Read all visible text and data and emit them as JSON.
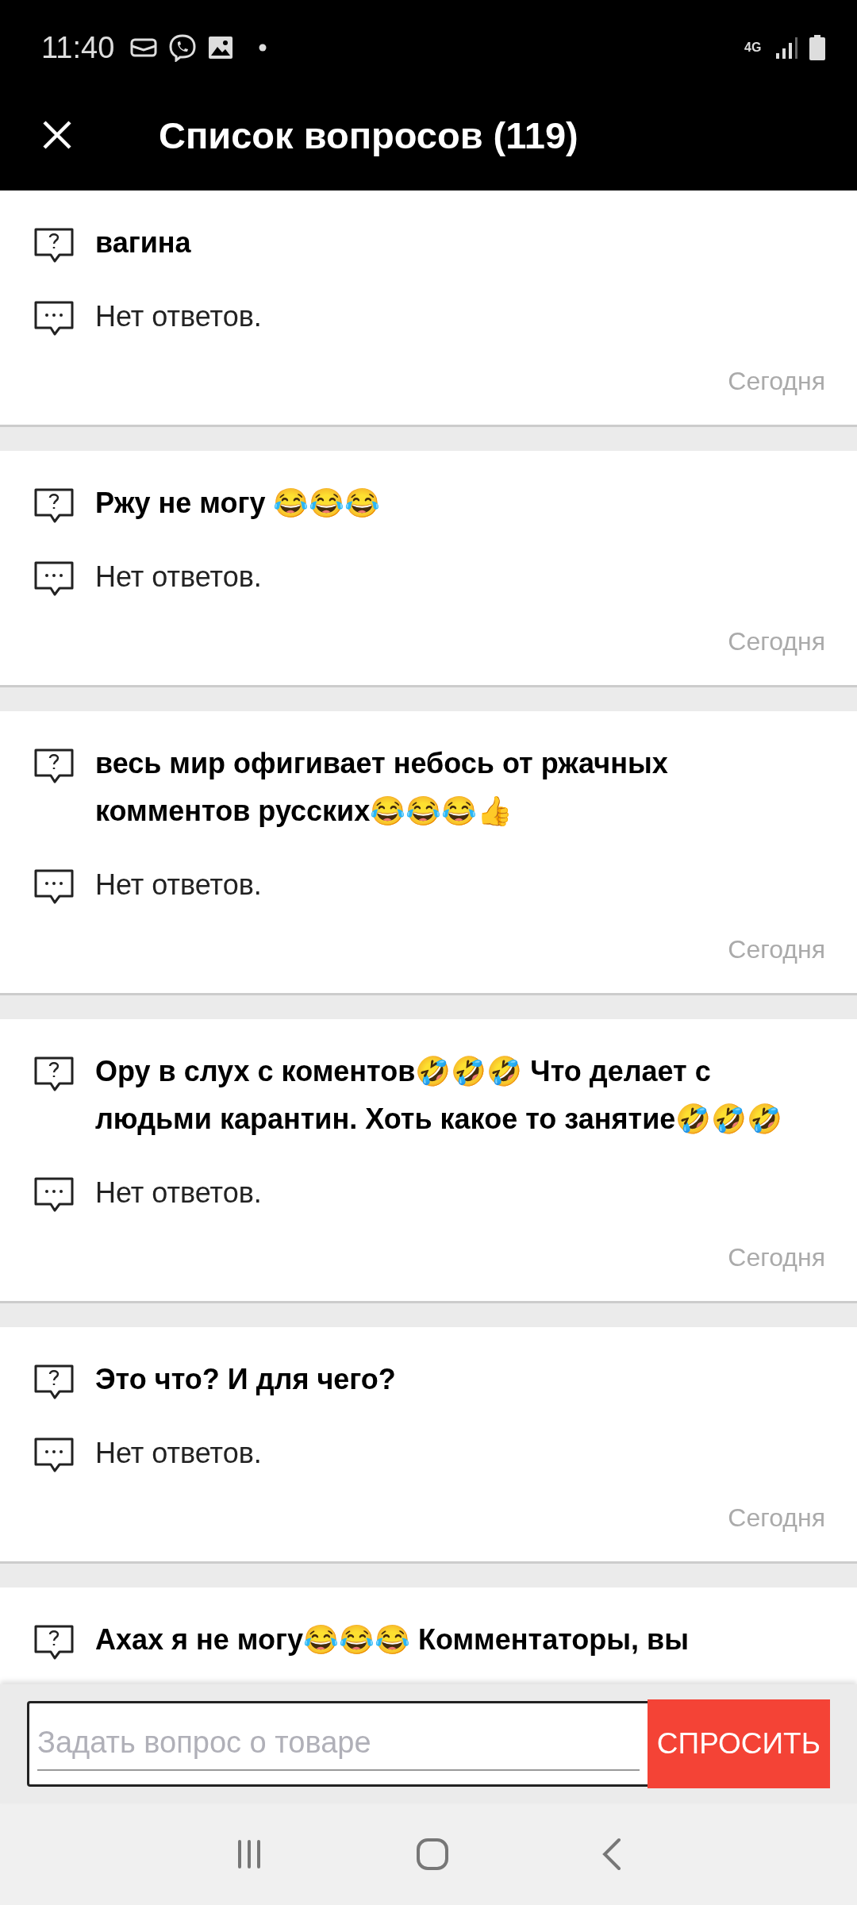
{
  "status_bar": {
    "time": "11:40",
    "network": "4G"
  },
  "header": {
    "title": "Список вопросов (119)"
  },
  "questions": [
    {
      "question": "вагина",
      "answer": "Нет ответов.",
      "date": "Сегодня"
    },
    {
      "question": "Ржу не могу 😂😂😂",
      "answer": "Нет ответов.",
      "date": "Сегодня"
    },
    {
      "question": "весь мир офигивает небось от ржачных комментов русских😂😂😂👍",
      "answer": "Нет ответов.",
      "date": "Сегодня"
    },
    {
      "question": "Ору в слух с коментов🤣🤣🤣 Что делает с людьми карантин. Хоть какое то занятие🤣🤣🤣",
      "answer": "Нет ответов.",
      "date": "Сегодня"
    },
    {
      "question": "Это что? И для чего?",
      "answer": "Нет ответов.",
      "date": "Сегодня"
    },
    {
      "question": "Ахах я не могу😂😂😂 Комментаторы, вы"
    }
  ],
  "ask": {
    "placeholder": "Задать вопрос о товаре",
    "button": "СПРОСИТЬ"
  }
}
